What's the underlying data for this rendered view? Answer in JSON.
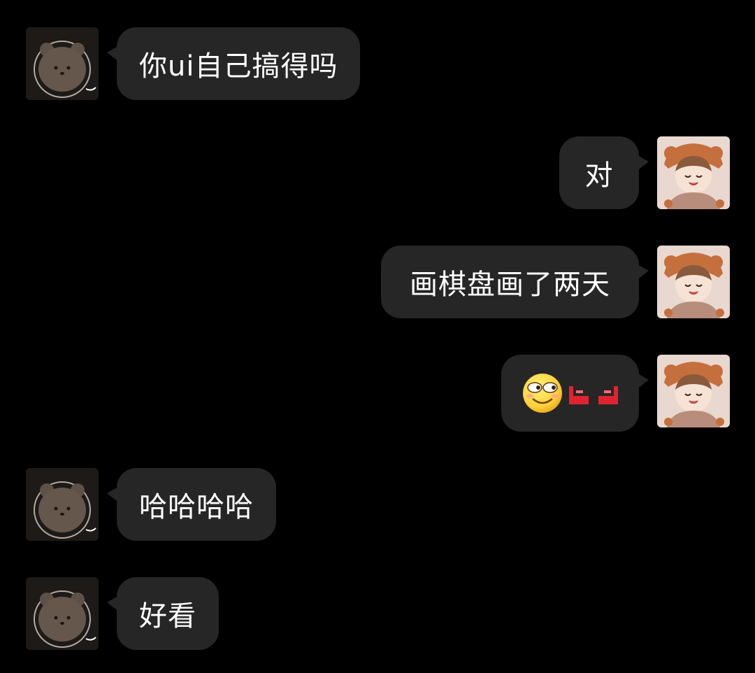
{
  "colors": {
    "background": "#000000",
    "bubble": "#262626",
    "text": "#ffffff",
    "accent_red": "#e0242f",
    "emoji_yellow": "#ffd23a"
  },
  "messages": [
    {
      "side": "left",
      "avatar": "bear-avatar",
      "text": "你ui自己搞得吗"
    },
    {
      "side": "right",
      "avatar": "anime-girl-avatar",
      "text": "对"
    },
    {
      "side": "right",
      "avatar": "anime-girl-avatar",
      "text": "画棋盘画了两天"
    },
    {
      "side": "right",
      "avatar": "anime-girl-avatar",
      "emojis": [
        "smirk-face-emoji",
        "red-angry-eyebrows-emoji"
      ]
    },
    {
      "side": "left",
      "avatar": "bear-avatar",
      "text": "哈哈哈哈"
    },
    {
      "side": "left",
      "avatar": "bear-avatar",
      "text": "好看"
    }
  ]
}
